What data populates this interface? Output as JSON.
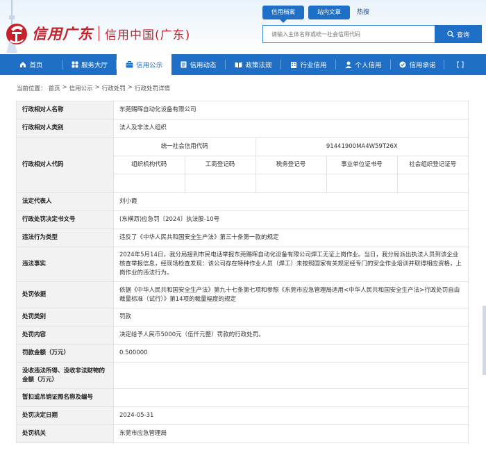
{
  "brand": {
    "calligraphy": "信用广东",
    "subtitle": "信用中国(广东)"
  },
  "top_tabs": [
    {
      "label": "信用档案",
      "active": true
    },
    {
      "label": "站内文章",
      "active": false
    }
  ],
  "hot_label": "热搜",
  "search": {
    "placeholder": "请输入主体名称或统一社会信用代码",
    "button": "查询"
  },
  "nav": [
    {
      "label": "首页",
      "icon": "home-icon",
      "active": false
    },
    {
      "label": "服务大厅",
      "icon": "grid-icon",
      "active": false
    },
    {
      "label": "信用公示",
      "icon": "briefcase-icon",
      "active": true
    },
    {
      "label": "信用动态",
      "icon": "document-icon",
      "active": false
    },
    {
      "label": "政策法规",
      "icon": "book-icon",
      "active": false
    },
    {
      "label": "行业信用",
      "icon": "building-icon",
      "active": false
    },
    {
      "label": "个人信用",
      "icon": "person-icon",
      "active": false
    },
    {
      "label": "信用承诺",
      "icon": "promise-icon",
      "active": false
    }
  ],
  "breadcrumb": {
    "prefix": "当前位置：",
    "items": [
      "首页",
      ">",
      "信用公示",
      ">",
      "行政处罚",
      ">",
      "行政处罚详情"
    ]
  },
  "detail": {
    "subject_name_label": "行政相对人名称",
    "subject_name": "东莞赐晖自动化设备有限公司",
    "subject_type_label": "行政相对人类别",
    "subject_type": "法人及非法人组织",
    "subject_code_label": "行政相对人代码",
    "uscc_label": "统一社会信用代码",
    "uscc_value": "91441900MA4W59T26X",
    "code_headers": [
      "组织机构代码",
      "工商登记码",
      "税务登记号",
      "事业单位证书号",
      "社会组织登记证号"
    ],
    "code_values": [
      "",
      "",
      "",
      "",
      ""
    ],
    "legal_rep_label": "法定代表人",
    "legal_rep": "刘小霞",
    "decision_no_label": "行政处罚决定书文号",
    "decision_no": "(东横沥)应急罚〔2024〕执法股-10号",
    "violation_type_label": "违法行为类型",
    "violation_type": "违反了《中华人民共和国安全生产法》第三十条第一款的规定",
    "facts_label": "违法事实",
    "facts": "2024年5月14日，我分局接到市民电话举报东莞赐晖自动化设备有限公司焊工无证上岗作业。当日，我分局派出执法人员到该企业核查举报信息，经现场检查发现：该公司存在特种作业人员（焊工）未按照国家有关规定经专门的安全作业培训并取得相应资格，上岗作业的违法行为。",
    "basis_label": "处罚依据",
    "basis": "依据《中华人民共和国安全生产法》第九十七条第七项和参照《东莞市应急管理局适用<中华人民共和国安全生产法>行政处罚自由裁量标准（试行）》第14项的裁量幅度的规定",
    "category_label": "处罚类别",
    "category": "罚款",
    "content_label": "处罚内容",
    "content": "决定给予人民币5000元（伍仟元整）罚款的行政处罚。",
    "amount_label": "罚款金额（万元）",
    "amount": "0.500000",
    "confiscation_label": "没收违法所得、没收非法财物的金额（万元）",
    "confiscation": "",
    "license_label": "暂扣或吊销证照名称及编号",
    "license": "",
    "date_label": "处罚决定日期",
    "date": "2024-05-31",
    "authority_label": "处罚机关",
    "authority": "东莞市应急管理局"
  },
  "colors": {
    "brand_blue": "#1f6fc6",
    "brand_red": "#c8202a",
    "label_bg": "#f2f2f2"
  }
}
